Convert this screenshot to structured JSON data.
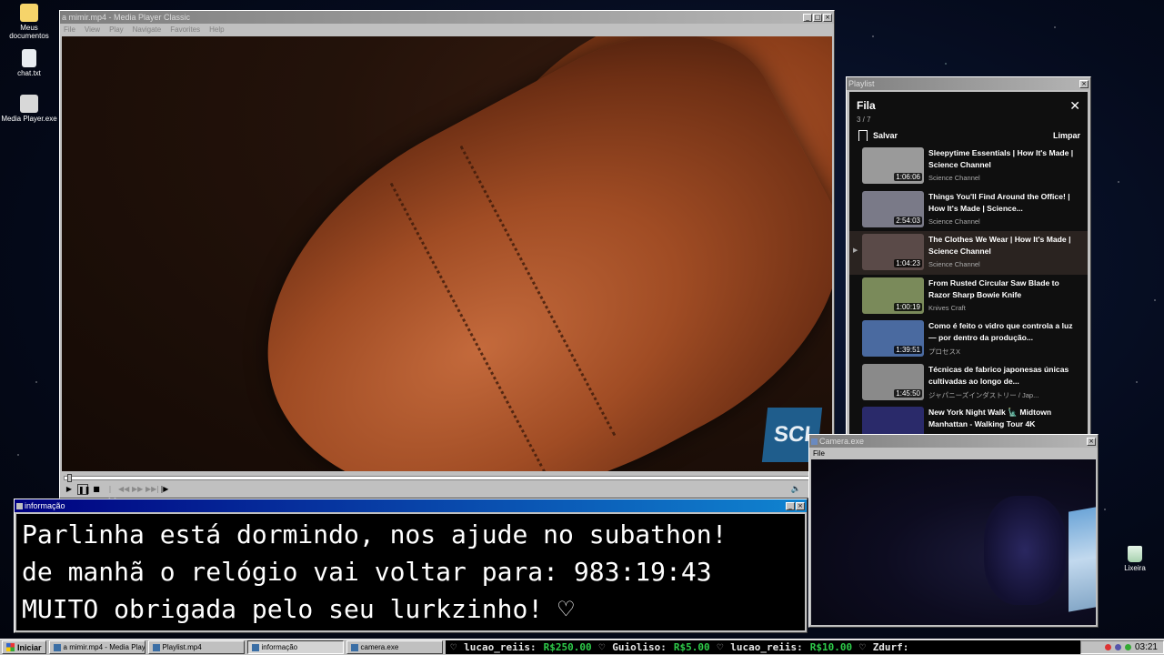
{
  "desktop": {
    "icons": [
      {
        "label": "Meus documentos"
      },
      {
        "label": "chat.txt"
      },
      {
        "label": "Media Player.exe"
      },
      {
        "label": "Lixeira"
      }
    ]
  },
  "media_player": {
    "title": "a mimir.mp4 - Media Player Classic",
    "menu": [
      "File",
      "View",
      "Play",
      "Navigate",
      "Favorites",
      "Help"
    ],
    "logo_text": "SCI"
  },
  "playlist": {
    "window_title": "Playlist",
    "heading": "Fila",
    "count": "3 / 7",
    "save_label": "Salvar",
    "clear_label": "Limpar",
    "items": [
      {
        "title": "Sleepytime Essentials | How It's Made | Science Channel",
        "channel": "Science Channel",
        "duration": "1:06:06",
        "thumb": "#9a9a9a"
      },
      {
        "title": "Things You'll Find Around the Office! | How It's Made | Science...",
        "channel": "Science Channel",
        "duration": "2:54:03",
        "thumb": "#7a7a88"
      },
      {
        "title": "The Clothes We Wear | How It's Made | Science Channel",
        "channel": "Science Channel",
        "duration": "1:04:23",
        "thumb": "#5a4a48"
      },
      {
        "title": "From Rusted Circular Saw Blade to Razor Sharp Bowie Knife",
        "channel": "Knives Craft",
        "duration": "1:00:19",
        "thumb": "#7a8a5a"
      },
      {
        "title": "Como é feito o vidro que controla a luz — por dentro da produção...",
        "channel": "プロセスX",
        "duration": "1:39:51",
        "thumb": "#4a6aa0"
      },
      {
        "title": "Técnicas de fabrico japonesas únicas cultivadas ao longo de...",
        "channel": "ジャパニーズインダストリー / Jap...",
        "duration": "1:45:50",
        "thumb": "#8a8a8a"
      },
      {
        "title": "New York Night Walk 🗽 Midtown Manhattan - Walking Tour 4K",
        "channel": "",
        "duration": "",
        "thumb": "#2a2a6a"
      }
    ]
  },
  "info": {
    "title": "informação",
    "lines": [
      "Parlinha está dormindo, nos ajude no subathon!",
      "de manhã o relógio vai voltar para:  983:19:43",
      "MUITO obrigada pelo seu lurkzinho! ♡"
    ]
  },
  "camera": {
    "title": "Camera.exe",
    "menu": "File"
  },
  "taskbar": {
    "start_label": "Iniciar",
    "tasks": [
      {
        "label": "a mimir.mp4 - Media Playe..."
      },
      {
        "label": "Playlist.mp4"
      },
      {
        "label": "informação"
      },
      {
        "label": "camera.exe"
      }
    ],
    "ticker": [
      {
        "user": "lucao_reiis:",
        "amount": "R$250.00"
      },
      {
        "user": "Guioliso:",
        "amount": "R$5.00"
      },
      {
        "user": "lucao_reiis:",
        "amount": "R$10.00"
      },
      {
        "user": "Zdurf:",
        "amount": ""
      }
    ],
    "clock": "03:21"
  }
}
